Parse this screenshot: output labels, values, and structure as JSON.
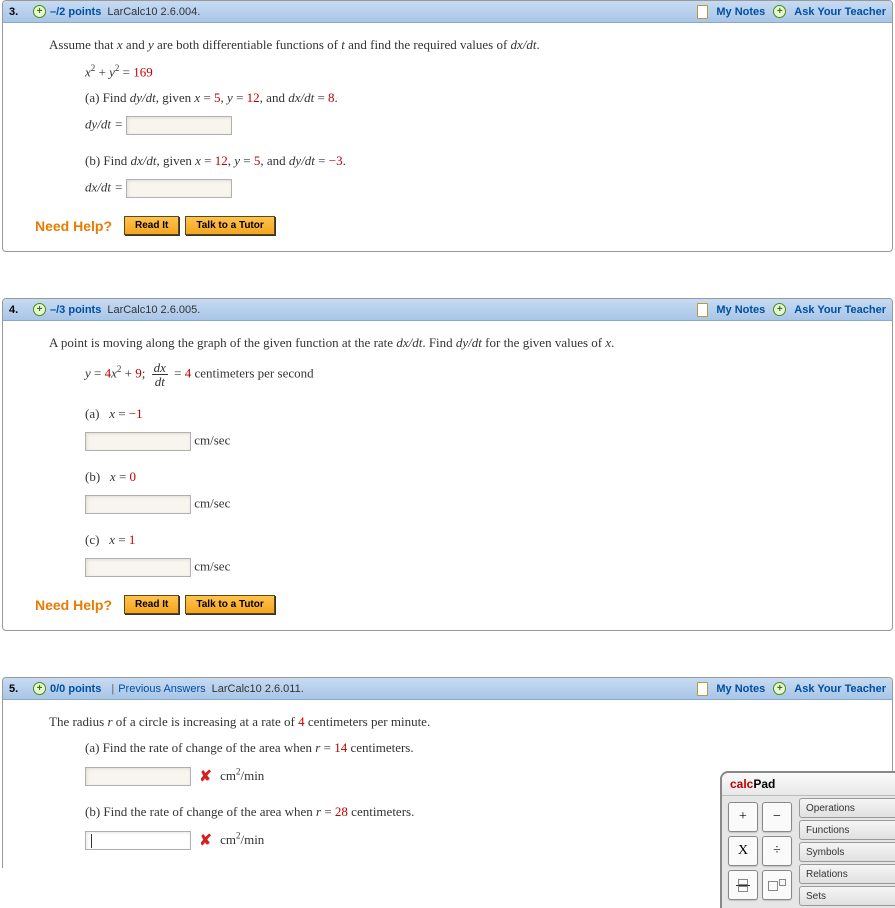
{
  "header_links": {
    "my_notes": "My Notes",
    "ask": "Ask Your Teacher"
  },
  "help": {
    "need": "Need Help?",
    "read": "Read It",
    "tutor": "Talk to a Tutor"
  },
  "q3": {
    "num": "3.",
    "points": "–/2 points",
    "ref": "LarCalc10 2.6.004.",
    "prompt_pre": "Assume that ",
    "prompt_mid1": " and ",
    "prompt_mid2": " are both differentiable functions of ",
    "prompt_post": " and find the required values of ",
    "prompt_dxdt": "dx/dt",
    "prompt_end": ".",
    "equation": {
      "lhs": "x",
      "exp1": "2",
      "plus": " + ",
      "y": "y",
      "exp2": "2",
      "eq": " = ",
      "rhs": "169"
    },
    "a": {
      "label_pre": "(a) Find ",
      "dydt": "dy/dt",
      "given": ", given ",
      "x": "x",
      "eq1": " = ",
      "xv": "5",
      "c1": ", ",
      "y": "y",
      "eq2": " = ",
      "yv": "12",
      "c2": ", and ",
      "dxdt": "dx/dt",
      "eq3": " = ",
      "dv": "8",
      "dot": ".",
      "answer_label": "dy/dt =",
      "ans_eq": " "
    },
    "b": {
      "label_pre": "(b) Find ",
      "dxdt": "dx/dt",
      "given": ", given ",
      "x": "x",
      "eq1": " = ",
      "xv": "12",
      "c1": ", ",
      "y": "y",
      "eq2": " = ",
      "yv": "5",
      "c2": ", and ",
      "dydt": "dy/dt",
      "eq3": " = ",
      "dv": "−3",
      "dot": ".",
      "answer_label": "dx/dt ="
    }
  },
  "q4": {
    "num": "4.",
    "points": "–/3 points",
    "ref": "LarCalc10 2.6.005.",
    "prompt_pre": "A point is moving along the graph of the given function at the rate ",
    "dxdt": "dx/dt",
    "prompt_mid": ".  Find ",
    "dydt": "dy/dt",
    "prompt_post": " for the given values of ",
    "x": "x",
    "dot": ".",
    "eq": {
      "y": "y",
      "eq": " = ",
      "four": "4",
      "xv": "x",
      "exp": "2",
      "plus": " + ",
      "nine": "9",
      "semi": "; ",
      "frac_n": "dx",
      "frac_d": "dt",
      "eq2": " = ",
      "val": "4",
      "unit": " centimeters per second"
    },
    "a": {
      "lab": "(a)",
      "x": "x",
      "eq": " = ",
      "val": "−1",
      "unit": "cm/sec"
    },
    "b": {
      "lab": "(b)",
      "x": "x",
      "eq": " = ",
      "val": "0",
      "unit": "cm/sec"
    },
    "c": {
      "lab": "(c)",
      "x": "x",
      "eq": " = ",
      "val": "1",
      "unit": "cm/sec"
    }
  },
  "q5": {
    "num": "5.",
    "points": "0/0 points",
    "prev": "Previous Answers",
    "ref": "LarCalc10 2.6.011.",
    "prompt_pre": "The radius ",
    "r": "r",
    "prompt_mid": " of a circle is increasing at a rate of ",
    "rate": "4",
    "prompt_post": " centimeters per minute.",
    "a": {
      "lab": "(a) Find the rate of change of the area when ",
      "r": "r",
      "eq": " = ",
      "val": "14",
      "unit_txt": " centimeters.",
      "ans_unit_pre": "cm",
      "exp": "2",
      "ans_unit_post": "/min"
    },
    "b": {
      "lab": "(b) Find the rate of change of the area when ",
      "r": "r",
      "eq": " = ",
      "val": "28",
      "unit_txt": " centimeters.",
      "ans_unit_pre": "cm",
      "exp": "2",
      "ans_unit_post": "/min"
    }
  },
  "calcpad": {
    "title_pre": "calc",
    "title_post": "Pad",
    "ops": {
      "plus": "+",
      "minus": "−",
      "times": "X",
      "div": "÷"
    },
    "tabs": {
      "ops": "Operations",
      "func": "Functions",
      "sym": "Symbols",
      "rel": "Relations",
      "sets": "Sets"
    }
  }
}
